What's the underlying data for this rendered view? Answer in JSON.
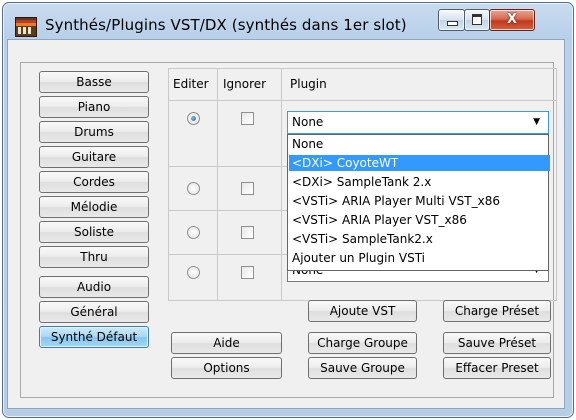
{
  "window": {
    "title": "Synthés/Plugins VST/DX (synthés dans 1er slot)",
    "icons": {
      "app": "synth-keyboard-icon",
      "minimize": "minimize-icon",
      "maximize": "maximize-icon",
      "close": "close-icon"
    },
    "close_glyph": "X"
  },
  "side_buttons": [
    {
      "label": "Basse",
      "active": false
    },
    {
      "label": "Piano",
      "active": false
    },
    {
      "label": "Drums",
      "active": false
    },
    {
      "label": "Guitare",
      "active": false
    },
    {
      "label": "Cordes",
      "active": false
    },
    {
      "label": "Mélodie",
      "active": false
    },
    {
      "label": "Soliste",
      "active": false
    },
    {
      "label": "Thru",
      "active": false
    },
    {
      "label": "Audio",
      "active": false
    },
    {
      "label": "Général",
      "active": false
    },
    {
      "label": "Synthé Défaut",
      "active": true
    }
  ],
  "grid": {
    "headers": {
      "editer": "Editer",
      "ignorer": "Ignorer",
      "plugin": "Plugin"
    },
    "rows": [
      {
        "edit_selected": true,
        "ignore_checked": false,
        "plugin": "None"
      },
      {
        "edit_selected": false,
        "ignore_checked": false,
        "plugin": ""
      },
      {
        "edit_selected": false,
        "ignore_checked": false,
        "plugin": ""
      },
      {
        "edit_selected": false,
        "ignore_checked": false,
        "plugin": "None"
      }
    ]
  },
  "plugin_dropdown": {
    "options": [
      "None",
      "<DXi> CoyoteWT",
      "<DXi> SampleTank 2.x",
      "<VSTi> ARIA Player Multi VST_x86",
      "<VSTi> ARIA Player VST_x86",
      "<VSTi> SampleTank2.x",
      "Ajouter un Plugin  VSTi"
    ],
    "highlighted_index": 1
  },
  "buttons": {
    "aide": "Aide",
    "options": "Options",
    "ajoute_vst": "Ajoute VST",
    "charge_groupe": "Charge Groupe",
    "sauve_groupe": "Sauve Groupe",
    "charge_preset": "Charge Préset",
    "sauve_preset": "Sauve Préset",
    "effacer_preset": "Effacer Preset"
  },
  "colors": {
    "selection": "#3399ff",
    "active_button": "#a9d9f5",
    "close_button": "#c1371d"
  }
}
